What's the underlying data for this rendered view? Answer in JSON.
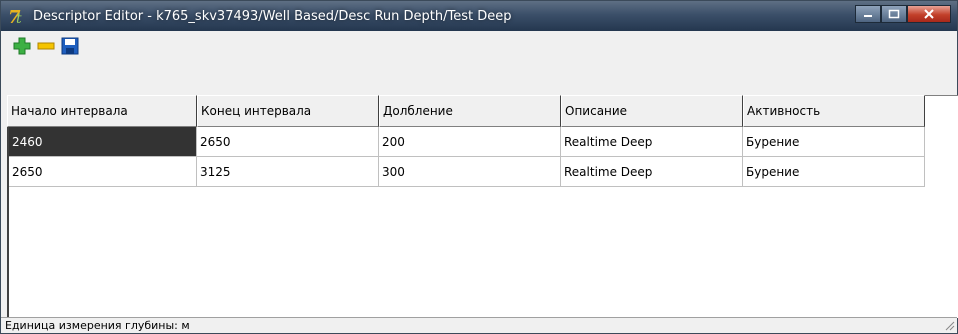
{
  "window": {
    "title": "Descriptor Editor - k765_skv37493/Well Based/Desc Run Depth/Test Deep",
    "app_icon": "app-logo-icon",
    "controls": [
      "minimize-icon",
      "maximize-icon",
      "close-icon"
    ]
  },
  "toolbar": {
    "buttons": [
      {
        "icon": "add-icon",
        "color": "#3cb043"
      },
      {
        "icon": "remove-icon",
        "color": "#f0b400"
      },
      {
        "icon": "save-icon",
        "color": "#1f5fbf"
      }
    ]
  },
  "table": {
    "columns": [
      "Начало интервала",
      "Конец интервала",
      "Долбление",
      "Описание",
      "Активность"
    ],
    "rows": [
      [
        "2460",
        "2650",
        "200",
        "Realtime Deep",
        "Бурение"
      ],
      [
        "2650",
        "3125",
        "300",
        "Realtime Deep",
        "Бурение"
      ]
    ],
    "selected_cell": [
      0,
      0
    ]
  },
  "status": {
    "text": "Единица измерения глубины: м"
  }
}
